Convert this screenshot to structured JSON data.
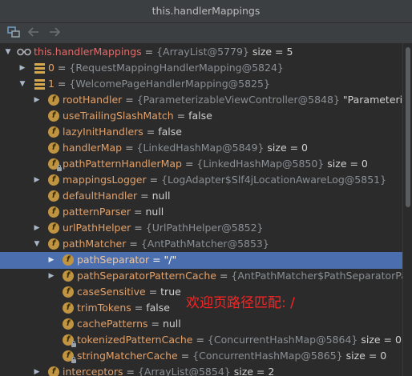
{
  "window": {
    "title": "this.handlerMappings"
  },
  "toolbar": {
    "icons": [
      "layout-icon",
      "back-arrow-icon",
      "forward-arrow-icon"
    ]
  },
  "tree": {
    "rows": [
      {
        "name": "this.handlerMappings",
        "eq": " = ",
        "ref": "{ArrayList@5779}",
        "val": "  size = 5"
      },
      {
        "name": "0",
        "eq": " = ",
        "ref": "{RequestMappingHandlerMapping@5824}",
        "val": ""
      },
      {
        "name": "1",
        "eq": " = ",
        "ref": "{WelcomePageHandlerMapping@5825}",
        "val": ""
      },
      {
        "name": "rootHandler",
        "eq": " = ",
        "ref": "{ParameterizableViewController@5848}",
        "val": " \"ParameterizableVie"
      },
      {
        "name": "useTrailingSlashMatch",
        "eq": " = ",
        "ref": "",
        "val": "false"
      },
      {
        "name": "lazyInitHandlers",
        "eq": " = ",
        "ref": "",
        "val": "false"
      },
      {
        "name": "handlerMap",
        "eq": " = ",
        "ref": "{LinkedHashMap@5849}",
        "val": "  size = 0"
      },
      {
        "name": "pathPatternHandlerMap",
        "eq": " = ",
        "ref": "{LinkedHashMap@5850}",
        "val": "  size = 0"
      },
      {
        "name": "mappingsLogger",
        "eq": " = ",
        "ref": "{LogAdapter$Slf4jLocationAwareLog@5851}",
        "val": ""
      },
      {
        "name": "defaultHandler",
        "eq": " = ",
        "ref": "",
        "val": "null"
      },
      {
        "name": "patternParser",
        "eq": " = ",
        "ref": "",
        "val": "null"
      },
      {
        "name": "urlPathHelper",
        "eq": " = ",
        "ref": "{UrlPathHelper@5852}",
        "val": ""
      },
      {
        "name": "pathMatcher",
        "eq": " = ",
        "ref": "{AntPathMatcher@5853}",
        "val": ""
      },
      {
        "name": "pathSeparator",
        "eq": " = ",
        "ref": "",
        "val": "\"/\""
      },
      {
        "name": "pathSeparatorPatternCache",
        "eq": " = ",
        "ref": "{AntPathMatcher$PathSeparatorPatternCa",
        "val": ""
      },
      {
        "name": "caseSensitive",
        "eq": " = ",
        "ref": "",
        "val": "true"
      },
      {
        "name": "trimTokens",
        "eq": " = ",
        "ref": "",
        "val": "false"
      },
      {
        "name": "cachePatterns",
        "eq": " = ",
        "ref": "",
        "val": "null"
      },
      {
        "name": "tokenizedPatternCache",
        "eq": " = ",
        "ref": "{ConcurrentHashMap@5864}",
        "val": "  size = 0"
      },
      {
        "name": "stringMatcherCache",
        "eq": " = ",
        "ref": "{ConcurrentHashMap@5865}",
        "val": "  size = 0"
      },
      {
        "name": "interceptors",
        "eq": " = ",
        "ref": "{ArrayList@5854}",
        "val": "  size = 2"
      }
    ]
  },
  "annotation": {
    "text": "欢迎页路径匹配: /"
  },
  "colors": {
    "selected_row": "#4b6eaf",
    "field_icon": "#c09441",
    "annotation": "#ff2222"
  }
}
